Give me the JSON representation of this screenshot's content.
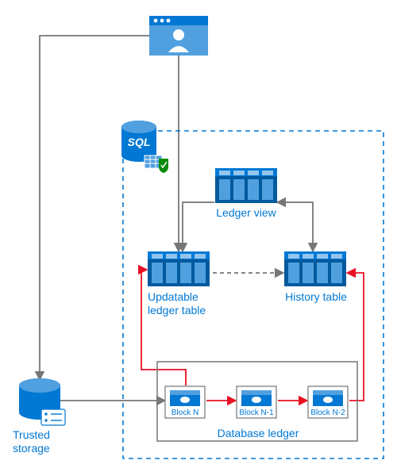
{
  "labels": {
    "sql": "SQL",
    "ledger_view": "Ledger view",
    "updatable_ledger_table": "Updatable\nledger table",
    "history_table": "History table",
    "trusted_storage": "Trusted\nstorage",
    "database_ledger": "Database ledger",
    "block_n": "Block N",
    "block_n1": "Block N-1",
    "block_n2": "Block N-2"
  },
  "colors": {
    "blue": "#0078d4",
    "blue_light": "#50a0e0",
    "blue_dark": "#005a9e",
    "red": "#e81123",
    "gray": "#767676"
  }
}
